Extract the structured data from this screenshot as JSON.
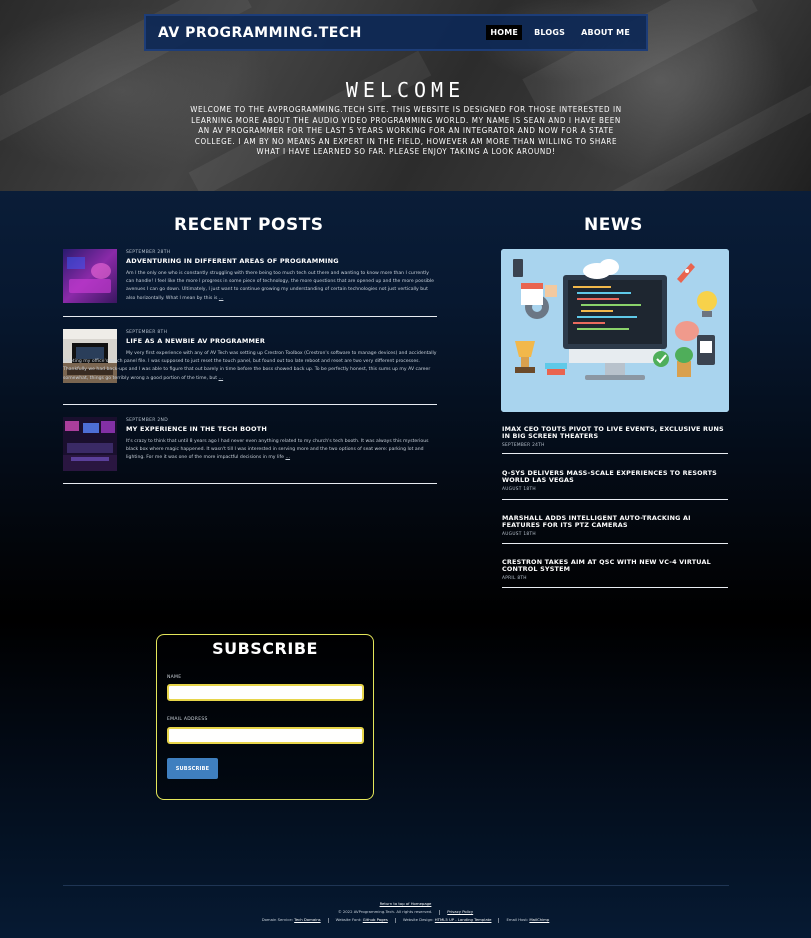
{
  "nav": {
    "brand": "AV PROGRAMMING.TECH",
    "links": [
      "HOME",
      "BLOGS",
      "ABOUT ME"
    ],
    "active_index": 0
  },
  "hero": {
    "title": "WELCOME",
    "text": "Welcome to the AVprogramming.tech site. This website is designed for those interested in learning more about the audio video programming world. My name is Sean and I have been an AV Programmer for the last 5 years working for an integrator and now for a state college. I am by no means an expert in the field, however am more than willing to share what I have learned so far. Please enjoy taking a look around!"
  },
  "recent_posts": {
    "heading": "RECENT POSTS",
    "posts": [
      {
        "date": "SEPTEMBER 28TH",
        "title": "ADVENTURING IN DIFFERENT AREAS OF PROGRAMMING",
        "excerpt": "Am I the only one who is constantly struggling with there being too much tech out there and wanting to know more than I currently can handle! I feel like the more I progress in some piece of technology, the more questions that are opened up and the more possible avenues I can go down. Ultimately, I just want to continue growing my understanding of certain technologies not just vertically but also horizontally. What I mean by this is",
        "more": "…"
      },
      {
        "date": "SEPTEMBER 8TH",
        "title": "LIFE AS A NEWBIE AV PROGRAMMER",
        "excerpt": "My very first experience with any of AV Tech was setting up Crestron Toolbox (Crestron's software to manage devices) and accidentally deleting my office's touch panel file. I was supposed to just reset the touch panel, but found out too late reboot and reset are two very different processes. Thankfully we had back-ups and I was able to figure that out barely in time before the boss showed back up. To be perfectly honest, this sums up my AV career somewhat, things go terribly wrong a good portion of the time, but",
        "more": "…"
      },
      {
        "date": "SEPTEMBER 2ND",
        "title": "MY EXPERIENCE IN THE TECH BOOTH",
        "excerpt": "It's crazy to think that until 8 years ago I had never even anything related to my church's tech booth. It was always this mysterious black box where magic happened. It wasn't till I was interested in serving more and the two options of seat were: parking lot and lighting. For me it was one of the more impactful decisions in my life",
        "more": "…"
      }
    ]
  },
  "news": {
    "heading": "NEWS",
    "items": [
      {
        "title": "IMAX CEO Touts Pivot to Live Events, Exclusive Runs in Big Screen Theaters",
        "date": "SEPTEMBER 24TH"
      },
      {
        "title": "Q-SYS Delivers Mass-Scale Experiences to Resorts World Las Vegas",
        "date": "AUGUST 18TH"
      },
      {
        "title": "Marshall Adds Intelligent Auto-Tracking AI Features for its PTZ Cameras",
        "date": "AUGUST 18TH"
      },
      {
        "title": "Crestron Takes Aim at QSC With New VC-4 Virtual Control System",
        "date": "APRIL 8TH"
      }
    ]
  },
  "subscribe": {
    "heading": "SUBSCRIBE",
    "name_label": "NAME",
    "email_label": "EMAIL ADDRESS",
    "name_value": "",
    "email_value": "",
    "button": "SUBSCRIBE"
  },
  "footer": {
    "back_to_top": "Return to top of Homepage",
    "copyright": "© 2022 AVProgramming.Tech. All rights reserved.",
    "privacy": "Privacy Policy",
    "domain_label": "Domain Service:",
    "domain_link": "Tech Domains",
    "font_label": "Website Font:",
    "font_link": "Github Pages",
    "design_label": "Website Design:",
    "design_link": "HTML5 UP - Landing Template",
    "email_label": "Email Host:",
    "email_link": "MailChimp"
  },
  "colors": {
    "nav_bg": "#0d2856",
    "subscribe_border": "#e4e65a",
    "button": "#3f7fbf",
    "news_image_bg": "#a9d4ee"
  }
}
